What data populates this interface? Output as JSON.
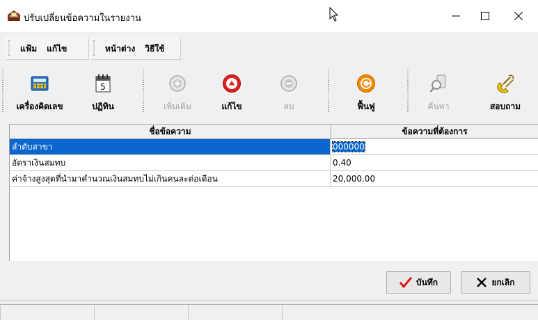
{
  "window": {
    "title": "ปรับเปลี่ยนข้อความในรายงาน",
    "minimize": "—",
    "maximize": "☐",
    "close": "✕"
  },
  "menu": {
    "group1": [
      "แฟ้ม",
      "แก้ไข"
    ],
    "group2": [
      "หน้าต่าง",
      "วิธีใช้"
    ]
  },
  "toolbar": {
    "calculator": "เครื่องคิดเลข",
    "calendar": "ปฏิทิน",
    "calendar_day": "5",
    "add": "เพิ่มเติม",
    "edit": "แก้ไข",
    "delete": "ลบ",
    "restore": "ฟื้นฟู",
    "search": "ค้นหา",
    "inquiry": "สอบถาม"
  },
  "grid": {
    "headers": [
      "ชื่อข้อความ",
      "ข้อความที่ต้องการ"
    ],
    "rows": [
      {
        "name": "ลำดับสาขา",
        "value": "000000",
        "selected": true
      },
      {
        "name": "อัตราเงินสมทบ",
        "value": "0.40",
        "selected": false
      },
      {
        "name": "ค่าจ้างสูงสุดที่นำมาคำนวณเงินสมทบไม่เกินคนละต่อเดือน",
        "value": "20,000.00",
        "selected": false
      }
    ]
  },
  "buttons": {
    "save": "บันทึก",
    "cancel": "ยกเลิก"
  },
  "colors": {
    "selection": "#0a66cc",
    "edit_red": "#e02020",
    "restore_orange": "#f08a00",
    "disabled_gray": "#a0a0a0",
    "check_red": "#d81818"
  }
}
